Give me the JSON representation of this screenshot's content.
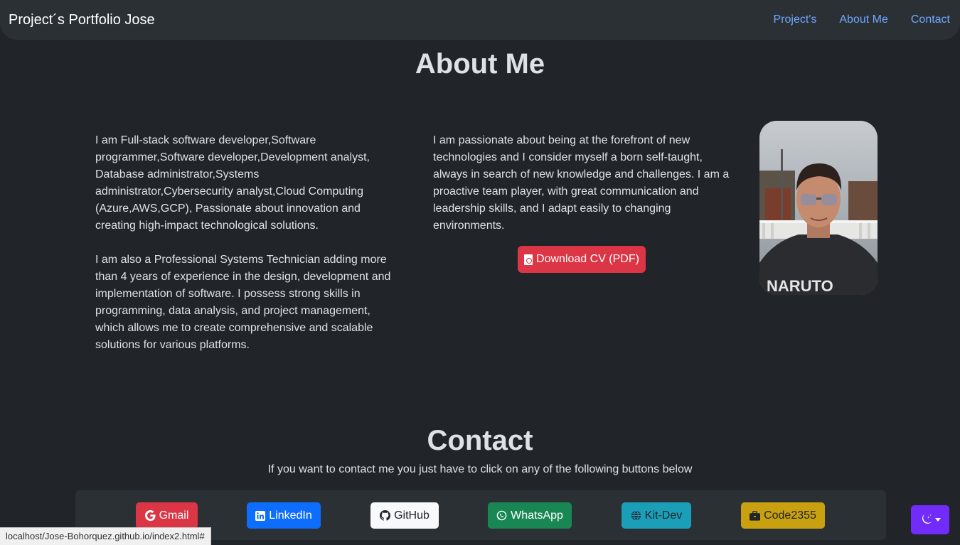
{
  "navbar": {
    "brand": "Project´s Portfolio Jose",
    "links": [
      "Project's",
      "About Me",
      "Contact"
    ]
  },
  "about": {
    "title": "About Me",
    "paragraph1": "I am Full-stack software developer,Software programmer,Software developer,Development analyst, Database administrator,Systems administrator,Cybersecurity analyst,Cloud Computing (Azure,AWS,GCP), Passionate about innovation and creating high-impact technological solutions.",
    "paragraph2": "I am also a Professional Systems Technician adding more than 4 years of experience in the design, development and implementation of software. I possess strong skills in programming, data analysis, and project management, which allows me to create comprehensive and scalable solutions for various platforms.",
    "paragraph3": "I am passionate about being at the forefront of new technologies and I consider myself a born self-taught, always in search of new knowledge and challenges. I am a proactive team player, with great communication and leadership skills, and I adapt easily to changing environments.",
    "cv_button": "Download CV (PDF)",
    "cv_icon": "file-pdf-icon"
  },
  "contact": {
    "title": "Contact",
    "subtitle": "If you want to contact me you just have to click on any of the following buttons below",
    "buttons": [
      {
        "label": "Gmail",
        "icon": "google-icon",
        "color": "#dc3545"
      },
      {
        "label": "LinkedIn",
        "icon": "linkedin-icon",
        "color": "#0d6efd"
      },
      {
        "label": "GitHub",
        "icon": "github-icon",
        "color": "#f8f9fa"
      },
      {
        "label": "WhatsApp",
        "icon": "whatsapp-icon",
        "color": "#198754"
      },
      {
        "label": "Kit-Dev",
        "icon": "globe-icon",
        "color": "#1b9fb9"
      },
      {
        "label": "Code2355",
        "icon": "briefcase-icon",
        "color": "#c9a00f"
      }
    ]
  },
  "theme_toggle": {
    "icon": "moon-stars-icon",
    "color": "#712cf9"
  },
  "status_bar": {
    "url": "localhost/Jose-Bohorquez.github.io/index2.html#"
  }
}
